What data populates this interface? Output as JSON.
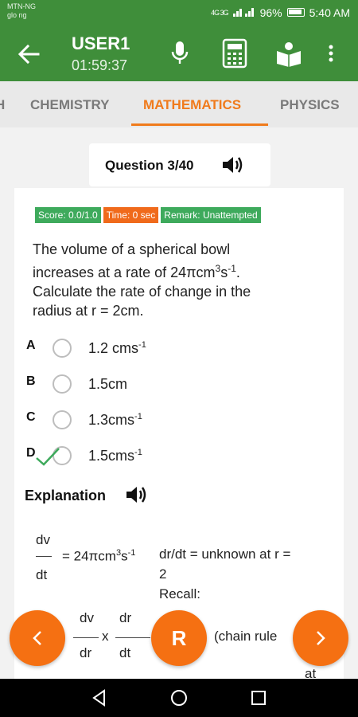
{
  "status": {
    "carrier_line1": "MTN-NG",
    "carrier_line2": "glo ng",
    "signal": "4G 3G",
    "battery": "96%",
    "time": "5:40 AM"
  },
  "appbar": {
    "title": "USER1",
    "timer": "01:59:37",
    "icons": [
      "back-arrow-icon",
      "microphone-icon",
      "calculator-icon",
      "reading-person-icon",
      "more-vert-icon"
    ]
  },
  "tabs": {
    "items": [
      "H",
      "CHEMISTRY",
      "MATHEMATICS",
      "PHYSICS"
    ],
    "active": "MATHEMATICS"
  },
  "question_header": {
    "label": "Question 3/40"
  },
  "badges": {
    "score": "Score: 0.0/1.0",
    "time": "Time: 0 sec",
    "remark": "Remark: Unattempted"
  },
  "question": {
    "line1": "The volume of a spherical bowl",
    "line2_pre": "increases at a rate of 24πcm",
    "line2_sup1": "3",
    "line2_mid": "s",
    "line2_sup2": "-1",
    "line2_post": ".",
    "line3": "Calculate the rate of change in the",
    "line4": "radius at r = 2cm."
  },
  "options": [
    {
      "letter": "A",
      "text": "1.2 cms",
      "sup": "-1"
    },
    {
      "letter": "B",
      "text": "1.5cm",
      "sup": ""
    },
    {
      "letter": "C",
      "text": "1.3cms",
      "sup": "-1"
    },
    {
      "letter": "D",
      "text": "1.5cms",
      "sup": "-1"
    }
  ],
  "explanation": {
    "heading": "Explanation",
    "frac1_num": "dv",
    "frac1_den": "dt",
    "eq": "= 24πcm",
    "eq_sup1": "3",
    "eq_s": "s",
    "eq_sup2": "-1",
    "drdt": "dr/dt = unknown at r =",
    "drdt2": "2",
    "recall": "Recall:",
    "frac2_num": "dv",
    "frac2_den": "dr",
    "times": "x",
    "frac3_num": "dr",
    "frac3_den": "dt",
    "chain": "(chain  rule",
    "at": "at"
  },
  "fabs": {
    "left": "‹",
    "center": "R",
    "right": "›"
  },
  "colors": {
    "green": "#3f8e3a",
    "orange": "#f07b1c",
    "badge_green": "#3eaa5c",
    "badge_orange": "#f06a1b"
  }
}
